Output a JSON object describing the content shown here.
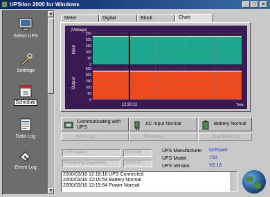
{
  "window": {
    "title": "UPSilon 2000 for Windows",
    "controls": [
      "_",
      "□",
      "×"
    ]
  },
  "sidebar": {
    "items": [
      {
        "label": "Select UPS",
        "icon": "monitor-icon"
      },
      {
        "label": "Settings",
        "icon": "wrench-icon"
      },
      {
        "label": "Schedule",
        "icon": "calendar-icon",
        "active": true
      },
      {
        "label": "Data Log",
        "icon": "data-log-icon"
      },
      {
        "label": "Event Log",
        "icon": "event-log-icon"
      }
    ]
  },
  "tabs": [
    "Meter",
    "Digital",
    "Block",
    "Chart"
  ],
  "active_tab": "Chart",
  "chart": {
    "ylabel_unit": "(Voltage)",
    "input_label": "Input",
    "output_label": "Output",
    "input_ticks": [
      "250",
      "200",
      "150",
      "100",
      "50",
      "0"
    ],
    "output_ticks": [
      "250",
      "200",
      "150",
      "100",
      "50",
      "0"
    ],
    "cursor_time": "12:30:11",
    "time_label": "Time",
    "colors": {
      "background": "#3a1a55",
      "input": "#1aa890",
      "output": "#f04818",
      "cursor": "#000000",
      "grid": "#8a8a8a"
    }
  },
  "chart_data": {
    "type": "area",
    "title": "",
    "xlabel": "Time",
    "ylabel": "(Voltage)",
    "series": [
      {
        "name": "Input",
        "values": [
          225,
          225,
          225,
          225,
          225,
          225,
          225,
          225,
          225,
          225
        ]
      },
      {
        "name": "Output",
        "values": [
          228,
          228,
          228,
          228,
          228,
          228,
          228,
          228,
          228,
          228
        ]
      }
    ],
    "ylim": [
      0,
      250
    ],
    "grid": true
  },
  "status": {
    "comm": "Communicating with UPS",
    "ac": "AC Input Normal",
    "battery": "Battery Normal"
  },
  "dim_buttons": [
    "Action List",
    "Shutdown",
    "Tray Event List"
  ],
  "fields": {
    "f1": "UPS Battery",
    "f2": "00:00:00",
    "f3": "Remaining Countdown",
    "f4": "00:00:00"
  },
  "ups_info": [
    {
      "label": "UPS Manufacturer",
      "value": "N-Power"
    },
    {
      "label": "UPS Model",
      "value": "700"
    },
    {
      "label": "UPS Version",
      "value": "V2.16"
    }
  ],
  "log": [
    "2000/03/16 12:18:16  UPS Connected",
    "2000/03/16 12:15:54  Battery Normal",
    "2000/03/16 12:15:54  Power Normal"
  ]
}
